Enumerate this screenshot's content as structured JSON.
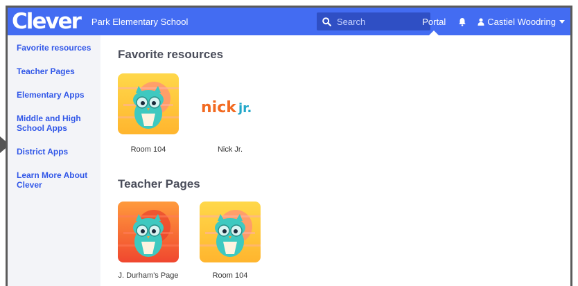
{
  "header": {
    "logo": "Clever",
    "school_name": "Park Elementary School",
    "search_placeholder": "Search",
    "portal_label": "Portal",
    "user_name": "Castiel Woodring"
  },
  "sidebar": {
    "items": [
      {
        "label": "Favorite resources"
      },
      {
        "label": "Teacher Pages"
      },
      {
        "label": "Elementary Apps"
      },
      {
        "label": "Middle and High School Apps"
      },
      {
        "label": "District Apps"
      },
      {
        "label": "Learn More About Clever"
      }
    ]
  },
  "main": {
    "favorites": {
      "title": "Favorite resources",
      "apps": [
        {
          "label": "Room 104",
          "icon": "owl-icon"
        },
        {
          "label": "Nick Jr.",
          "icon": "nick-jr-logo",
          "logo_text_a": "nick",
          "logo_text_b": "jr."
        }
      ]
    },
    "teacher_pages": {
      "title": "Teacher Pages",
      "apps": [
        {
          "label": "J. Durham's Page",
          "icon": "owl-icon"
        },
        {
          "label": "Room 104",
          "icon": "owl-icon"
        }
      ]
    }
  },
  "colors": {
    "brand": "#436cf2",
    "search_bg": "#2f4fc4",
    "sidebar_bg": "#f3f4f8",
    "link": "#3157e8",
    "owl_teal": "#3ec9c0",
    "nick_orange": "#f26a21",
    "nick_teal": "#22a7c9"
  }
}
